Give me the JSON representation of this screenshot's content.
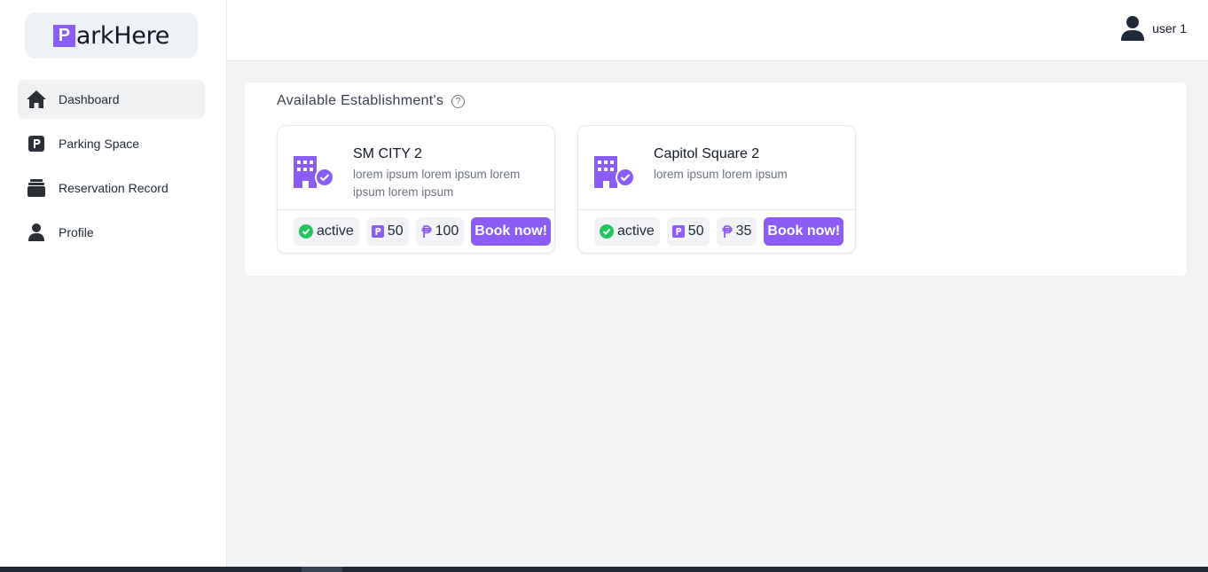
{
  "app": {
    "logo_letter": "P",
    "logo_rest": "arkHere"
  },
  "sidebar": {
    "items": [
      {
        "label": "Dashboard",
        "icon": "home-icon"
      },
      {
        "label": "Parking Space",
        "icon": "parking-icon"
      },
      {
        "label": "Reservation Record",
        "icon": "records-icon"
      },
      {
        "label": "Profile",
        "icon": "user-icon"
      }
    ]
  },
  "header": {
    "user_name": "user 1"
  },
  "main": {
    "title": "Available Establishment's",
    "cards": [
      {
        "name": "SM CITY 2",
        "description": "lorem ipsum lorem ipsum lorem ipsum lorem ipsum",
        "status": "active",
        "slots": "50",
        "rate": "100",
        "book_label": "Book now!"
      },
      {
        "name": "Capitol Square 2",
        "description": "lorem ipsum lorem ipsum",
        "status": "active",
        "slots": "50",
        "rate": "35",
        "book_label": "Book now!"
      }
    ]
  },
  "colors": {
    "accent": "#8b5cf6",
    "status_active": "#22c55e"
  }
}
